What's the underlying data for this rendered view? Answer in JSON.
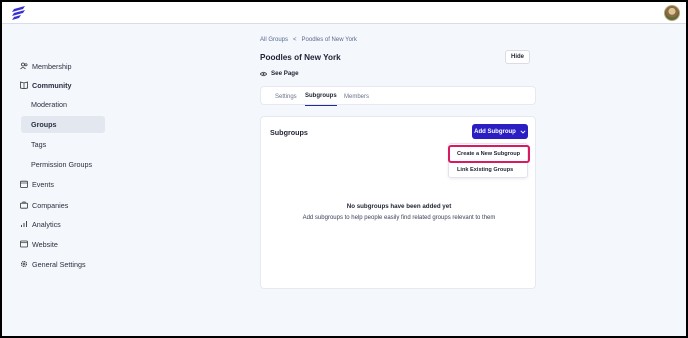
{
  "colors": {
    "accent": "#2b1fc4",
    "highlight": "#d81b60",
    "active_bg": "#e3e7ef"
  },
  "sidebar": {
    "membership": "Membership",
    "community": "Community",
    "moderation": "Moderation",
    "groups": "Groups",
    "tags": "Tags",
    "permission_groups": "Permission Groups",
    "events": "Events",
    "companies": "Companies",
    "analytics": "Analytics",
    "website": "Website",
    "general_settings": "General Settings"
  },
  "breadcrumb": {
    "parent": "All Groups",
    "separator": "<",
    "current": "Poodles of New York"
  },
  "page": {
    "title": "Poodles of New York",
    "hide_label": "Hide",
    "see_page_label": "See Page"
  },
  "tabs": {
    "settings": "Settings",
    "subgroups": "Subgroups",
    "members": "Members"
  },
  "subgroups": {
    "title": "Subgroups",
    "add_button": "Add Subgroup",
    "menu": {
      "create": "Create a New Subgroup",
      "link": "Link Existing Groups"
    },
    "empty_title": "No subgroups have been added yet",
    "empty_subtitle": "Add subgroups to help people easily find related groups relevant to them"
  }
}
